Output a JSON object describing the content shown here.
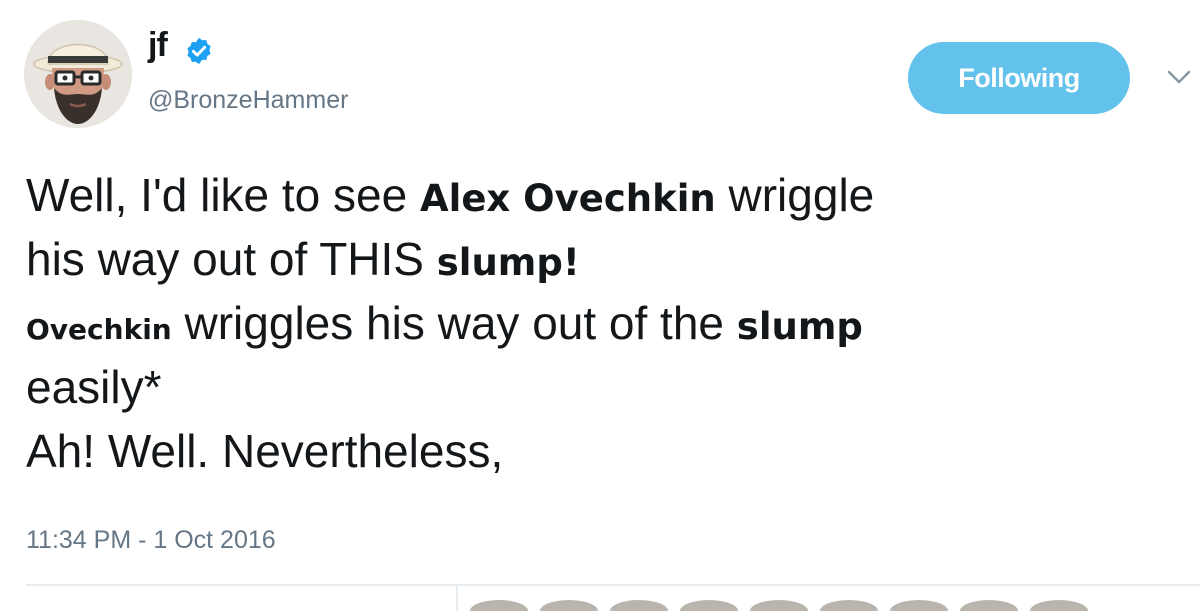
{
  "user": {
    "display_name": "jf",
    "handle": "@BronzeHammer",
    "verified": true
  },
  "follow_button": {
    "label": "Following"
  },
  "tweet": {
    "lines": [
      [
        {
          "text": "Well, I'd like to see ",
          "style": "normal"
        },
        {
          "text": "Alex Ovechkin",
          "style": "bold"
        },
        {
          "text": " wriggle",
          "style": "normal"
        }
      ],
      [
        {
          "text": "his way out of THIS ",
          "style": "normal"
        },
        {
          "text": "slump!",
          "style": "bold"
        }
      ],
      [
        {
          "text": "Ovechkin",
          "style": "bold-small"
        },
        {
          "text": " wriggles his way out of the ",
          "style": "normal"
        },
        {
          "text": "slump",
          "style": "bold"
        }
      ],
      [
        {
          "text": "easily*",
          "style": "normal"
        }
      ],
      [
        {
          "text": "Ah! Well. Nevertheless,",
          "style": "normal"
        }
      ]
    ],
    "timestamp": "11:34 PM - 1 Oct 2016"
  },
  "colors": {
    "follow_button_bg": "#63c2ec",
    "verified_badge": "#1da1f2",
    "secondary_text": "#657786",
    "primary_text": "#14171a"
  },
  "icons": {
    "avatar": "cartoon-bearded-man-with-glasses-and-hat",
    "verified": "verified-badge-icon",
    "caret": "chevron-down-icon"
  }
}
